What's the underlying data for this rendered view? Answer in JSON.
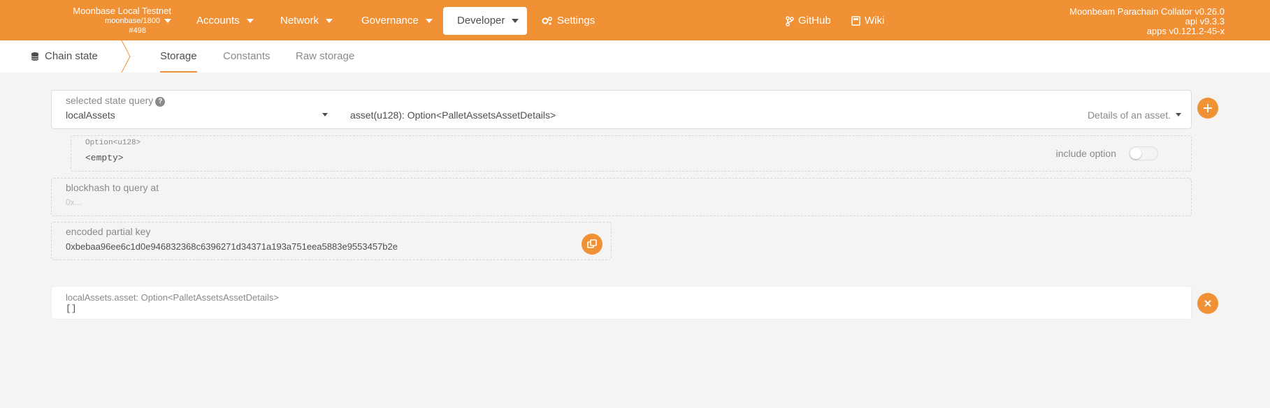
{
  "header": {
    "chain_name": "Moonbase Local Testnet",
    "chain_sub": "moonbase/1800",
    "block": "#498",
    "nav": [
      {
        "label": "Accounts"
      },
      {
        "label": "Network"
      },
      {
        "label": "Governance"
      },
      {
        "label": "Developer"
      },
      {
        "label": "Settings"
      },
      {
        "label": "GitHub"
      },
      {
        "label": "Wiki"
      }
    ],
    "version": {
      "node": "Moonbeam Parachain Collator v0.26.0",
      "api": "api v9.3.3",
      "apps": "apps v0.121.2-45-x"
    }
  },
  "subnav": {
    "section": "Chain state",
    "tabs": [
      {
        "label": "Storage",
        "active": true
      },
      {
        "label": "Constants"
      },
      {
        "label": "Raw storage"
      }
    ]
  },
  "query": {
    "label": "selected state query",
    "help": "?",
    "module": "localAssets",
    "method": "asset(u128): Option<PalletAssetsAssetDetails>",
    "doc": "Details of an asset."
  },
  "param": {
    "type": "Option<u128>",
    "value": "<empty>",
    "include_label": "include option",
    "include_enabled": false
  },
  "blockhash": {
    "label": "blockhash to query at",
    "placeholder": "0x..."
  },
  "encoded": {
    "label": "encoded partial key",
    "value": "0xbebaa96ee6c1d0e946832368c6396271d34371a193a751eea5883e9553457b2e"
  },
  "result": {
    "title": "localAssets.asset: Option<PalletAssetsAssetDetails>",
    "value": "[]"
  },
  "colors": {
    "accent": "#f19135",
    "background": "#f5f4f3"
  }
}
